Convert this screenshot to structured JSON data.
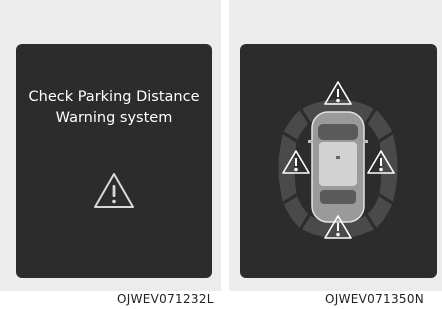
{
  "left_panel": {
    "message_line_1": "Check Parking Distance",
    "message_line_2": "Warning system",
    "icon": "warning-triangle-icon",
    "caption": "OJWEV071232L"
  },
  "right_panel": {
    "icon": "car-top-view-icon",
    "sensor_warnings": [
      "front",
      "left",
      "right",
      "rear"
    ],
    "caption": "OJWEV071350N"
  },
  "colors": {
    "screen": "#2c2c2c",
    "panel_background": "#ececec",
    "text": "#ffffff",
    "zone": "#4d4d4d"
  }
}
